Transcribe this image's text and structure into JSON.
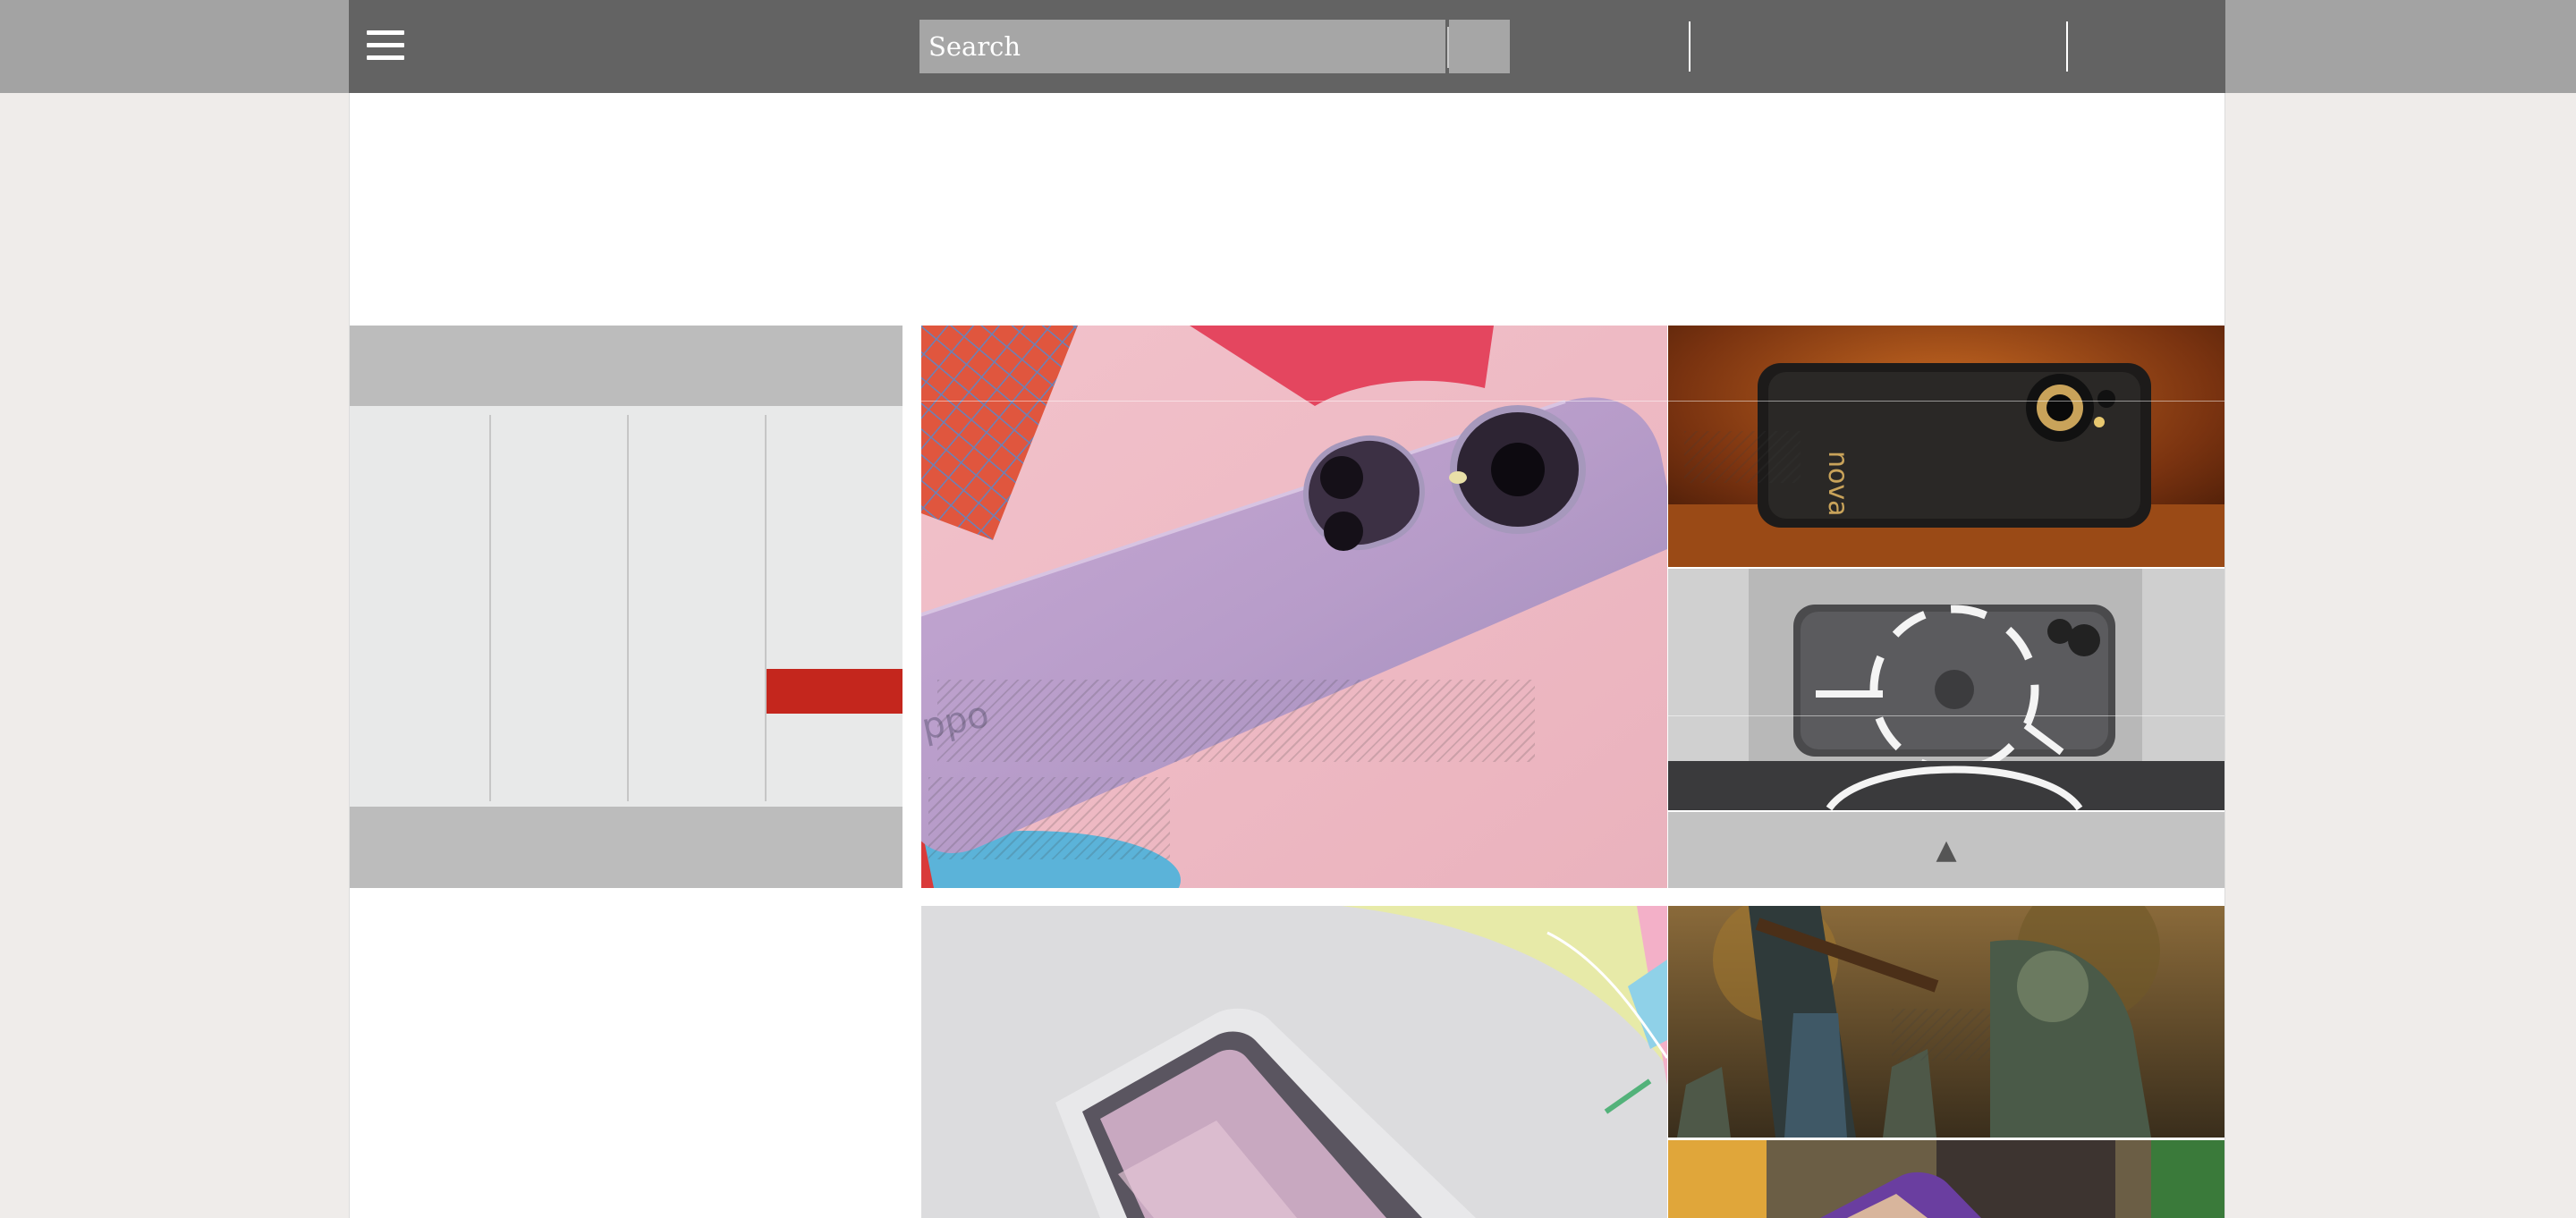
{
  "colors": {
    "header_bar": "#636363",
    "header_strip": "#a3a3a3",
    "page_background": "#efecea",
    "content_background": "#ffffff",
    "widget_gray": "#bcbcbc",
    "accent_red": "#c4261d"
  },
  "navbar": {
    "menu_icon": "hamburger-menu-icon",
    "search": {
      "placeholder": "Search",
      "value": ""
    }
  },
  "scroll_top": {
    "icon": "triangle-up-icon",
    "glyph": "▲"
  }
}
